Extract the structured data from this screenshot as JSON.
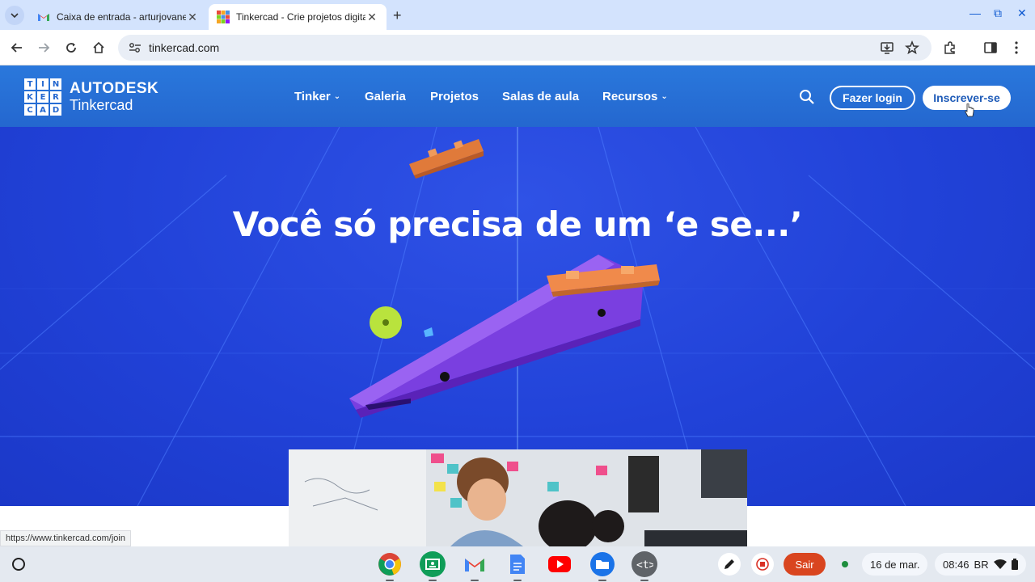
{
  "browser": {
    "tabs": [
      {
        "title": "Caixa de entrada - arturjovanel",
        "icon": "gmail-icon",
        "active": false
      },
      {
        "title": "Tinkercad - Crie projetos digitais",
        "icon": "tinkercad-favicon",
        "active": true
      }
    ],
    "url": "tinkercad.com",
    "status_url": "https://www.tinkercad.com/join"
  },
  "site": {
    "logo_letters": [
      "T",
      "I",
      "N",
      "K",
      "E",
      "R",
      "C",
      "A",
      "D"
    ],
    "brand_top": "AUTODESK",
    "brand_bottom": "Tinkercad",
    "nav": [
      {
        "label": "Tinker",
        "dropdown": true
      },
      {
        "label": "Galeria",
        "dropdown": false
      },
      {
        "label": "Projetos",
        "dropdown": false
      },
      {
        "label": "Salas de aula",
        "dropdown": false
      },
      {
        "label": "Recursos",
        "dropdown": true
      }
    ],
    "login_label": "Fazer login",
    "signup_label": "Inscrever-se",
    "hero_title": "Você só precisa de um ‘e se...’"
  },
  "shelf": {
    "apps": [
      "chrome-icon",
      "classroom-icon",
      "gmail-icon",
      "docs-icon",
      "youtube-icon",
      "files-icon",
      "terminal-icon"
    ],
    "sair_label": "Sair",
    "date": "16 de mar.",
    "time": "08:46",
    "keyboard": "BR"
  },
  "colors": {
    "header_blue": "#2467cf",
    "hero_blue": "#2142d8",
    "sair_red": "#d9451f"
  }
}
